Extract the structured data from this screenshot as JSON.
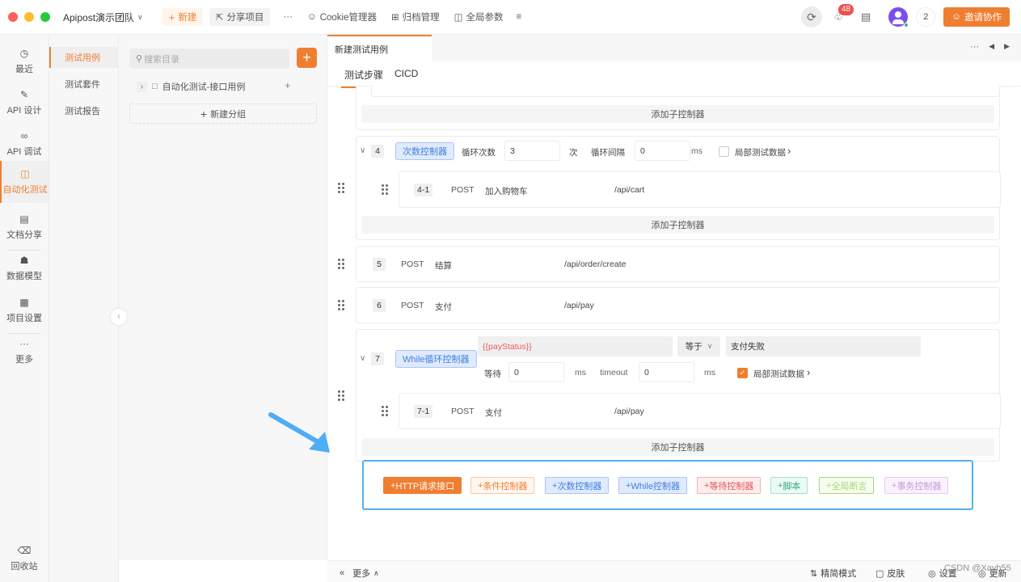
{
  "titlebar": {
    "team": "Apipost演示团队",
    "new_label": "新建",
    "share_label": "分享项目",
    "more": "···",
    "cookie_label": "Cookie管理器",
    "archive_label": "归档管理",
    "global_label": "全局参数",
    "notifications": "48",
    "online_count": "2",
    "invite_label": "邀请协作",
    "colors": {
      "accent": "#f07e31",
      "badge": "#f04d4d",
      "avatar": "#7a4ff0"
    }
  },
  "leftnav": {
    "items": [
      {
        "label": "最近",
        "icon": "history-icon"
      },
      {
        "label": "API 设计",
        "icon": "edit-icon"
      },
      {
        "label": "API 调试",
        "icon": "link-icon"
      },
      {
        "label": "自动化测试",
        "icon": "flow-icon",
        "active": true
      },
      {
        "label": "文档分享",
        "icon": "doc-icon"
      },
      {
        "label": "数据模型",
        "icon": "model-icon"
      },
      {
        "label": "项目设置",
        "icon": "folder-gear-icon"
      },
      {
        "label": "更多",
        "icon": "more-icon"
      }
    ],
    "trash_label": "回收站"
  },
  "subnav": {
    "items": [
      "测试用例",
      "测试套件",
      "测试报告"
    ],
    "active": "测试用例"
  },
  "tree": {
    "search_placeholder": "搜索目录",
    "folder_label": "自动化测试-接口用例",
    "new_group_label": "新建分组"
  },
  "main": {
    "tab_title": "新建测试用例",
    "tab_more": "···",
    "subtabs": [
      "测试步骤",
      "CICD"
    ],
    "add_child_label": "添加子控制器",
    "step4": {
      "num": "4",
      "tag": "次数控制器",
      "loop_count_label": "循环次数",
      "loop_count": "3",
      "times_unit": "次",
      "interval_label": "循环间隔",
      "interval": "0",
      "ms": "ms",
      "local_data_label": "局部测试数据",
      "local_data_checked": false,
      "child": {
        "num": "4-1",
        "method": "POST",
        "name": "加入购物车",
        "path": "/api/cart"
      }
    },
    "step5": {
      "num": "5",
      "method": "POST",
      "name": "结算",
      "path": "/api/order/create"
    },
    "step6": {
      "num": "6",
      "method": "POST",
      "name": "支付",
      "path": "/api/pay"
    },
    "step7": {
      "num": "7",
      "tag": "While循环控制器",
      "variable": "{{payStatus}}",
      "operator": "等于",
      "value": "支付失败",
      "wait_label": "等待",
      "wait": "0",
      "ms": "ms",
      "timeout_label": "timeout",
      "timeout": "0",
      "local_data_label": "局部测试数据",
      "local_data_checked": true,
      "child": {
        "num": "7-1",
        "method": "POST",
        "name": "支付",
        "path": "/api/pay"
      }
    },
    "controls": [
      {
        "label": "HTTP请求接口",
        "color": "#f07e31",
        "bg": "#f07e31",
        "fg": "#ffffff"
      },
      {
        "label": "条件控制器",
        "color": "#f7c9a5",
        "bg": "#fff7f0",
        "fg": "#f07e31"
      },
      {
        "label": "次数控制器",
        "color": "#a9c6f2",
        "bg": "#dfeafd",
        "fg": "#3f7fe0"
      },
      {
        "label": "While控制器",
        "color": "#a9c6f2",
        "bg": "#dfeafd",
        "fg": "#3f7fe0"
      },
      {
        "label": "等待控制器",
        "color": "#f1b2b2",
        "bg": "#fdecec",
        "fg": "#e05a5a"
      },
      {
        "label": "脚本",
        "color": "#a8e0cf",
        "bg": "#eafaf4",
        "fg": "#3aa783"
      },
      {
        "label": "全局断言",
        "color": "#a9d77a",
        "bg": "#f6fdee",
        "fg": "#a8d77a"
      },
      {
        "label": "事务控制器",
        "color": "#e8c9f3",
        "bg": "#faf1fd",
        "fg": "#c79ad9"
      }
    ]
  },
  "footer": {
    "more_label": "更多",
    "simple_mode": "精简模式",
    "skin": "皮肤",
    "settings": "设置",
    "update": "更新",
    "watermark": "CSDN @Xayh55"
  }
}
